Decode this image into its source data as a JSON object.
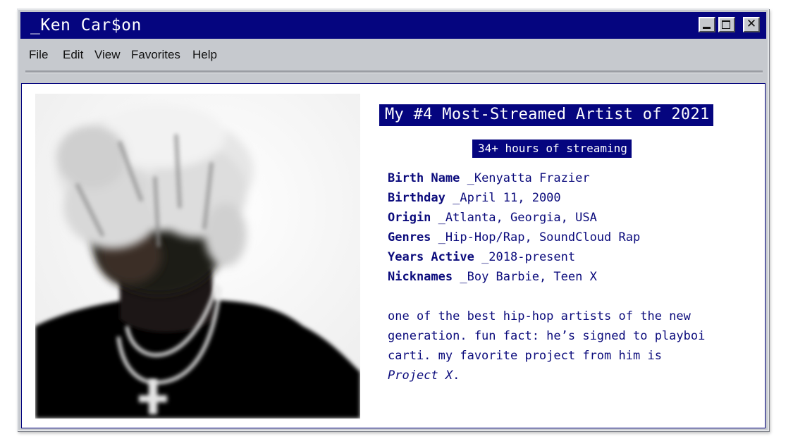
{
  "window": {
    "title": "_Ken Car$on",
    "controls": {
      "minimize_icon": "minimize-icon",
      "maximize_icon": "maximize-icon",
      "close_icon": "close-icon",
      "close_glyph": "✕"
    }
  },
  "menu": {
    "items": [
      {
        "label": "File"
      },
      {
        "label": "Edit"
      },
      {
        "label": "View"
      },
      {
        "label": "Favorites"
      },
      {
        "label": "Help"
      }
    ]
  },
  "main": {
    "heading": "My #4 Most-Streamed Artist of 2021",
    "subheading": "34+ hours of streaming",
    "facts": [
      {
        "key": "Birth Name",
        "value": " _Kenyatta Frazier"
      },
      {
        "key": "Birthday",
        "value": " _April 11, 2000"
      },
      {
        "key": "Origin",
        "value": " _Atlanta, Georgia, USA"
      },
      {
        "key": "Genres",
        "value": " _Hip-Hop/Rap, SoundCloud Rap"
      },
      {
        "key": "Years Active",
        "value": " _2018-present"
      },
      {
        "key": "Nicknames",
        "value": " _Boy Barbie, Teen X"
      }
    ],
    "blurb": {
      "line1": "one of the best hip-hop artists of the new",
      "line2": "generation. fun fact: he’s signed to playboi",
      "line3": "carti. my favorite project from him is",
      "project": "Project X",
      "period": "."
    }
  },
  "colors": {
    "titlebar": "#05057f",
    "window_chrome": "#c6c9ce",
    "text_accent": "#0b0b7c"
  }
}
